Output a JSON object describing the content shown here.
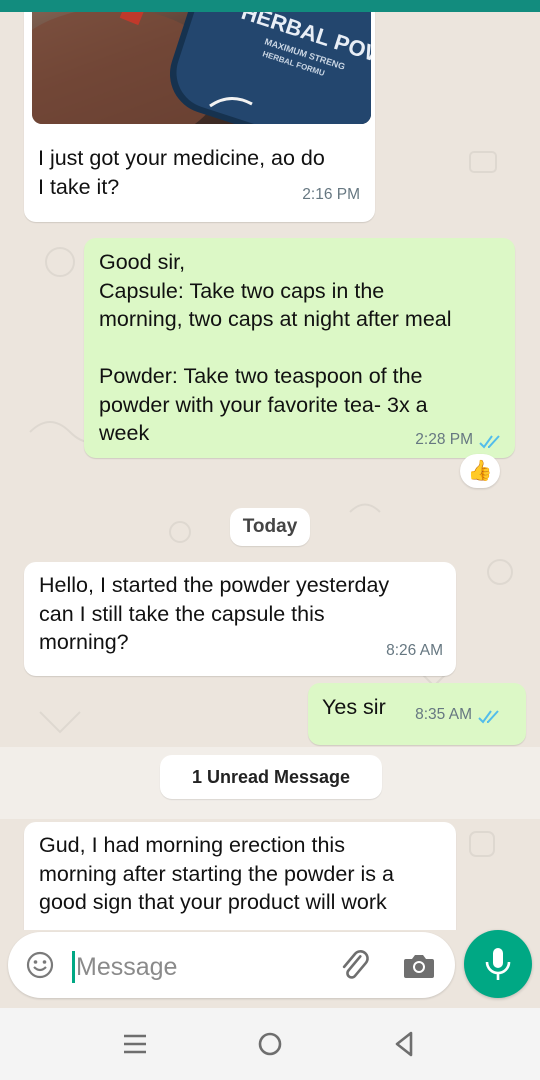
{
  "colors": {
    "header": "#128c7e",
    "incoming_bubble": "#ffffff",
    "outgoing_bubble": "#dcf8c6",
    "read_ticks": "#53bdeb",
    "mic_button": "#00a884"
  },
  "messages": [
    {
      "direction": "incoming",
      "has_image": true,
      "image_text": [
        "HERBAL POW",
        "MAXIMUM STRENG",
        "HERBAL FORMU"
      ],
      "text": "I just got your medicine, ao do\nI take it?",
      "time": "2:16 PM"
    },
    {
      "direction": "outgoing",
      "text": "Good sir,\nCapsule: Take two caps in the\nmorning, two caps at night after meal\n\nPowder: Take two teaspoon of the\npowder with your favorite tea- 3x a\nweek",
      "time": "2:28 PM",
      "status": "read",
      "reaction": "👍"
    },
    {
      "direction": "incoming",
      "text": "Hello, I started the powder yesterday\ncan I still take the capsule this\nmorning?",
      "time": "8:26 AM"
    },
    {
      "direction": "outgoing",
      "text": "Yes sir",
      "time": "8:35 AM",
      "status": "read"
    },
    {
      "direction": "incoming",
      "text": "Gud, I had morning erection this\nmorning after starting the powder is a\ngood sign that your product will work"
    }
  ],
  "date_separator": "Today",
  "unread_banner": "1 Unread Message",
  "composer": {
    "placeholder": "Message",
    "icons": [
      "emoji-icon",
      "attach-icon",
      "camera-icon"
    ]
  },
  "mic_icon": "mic-icon",
  "navbar": {
    "icons": [
      "recents-icon",
      "home-icon",
      "back-icon"
    ]
  }
}
